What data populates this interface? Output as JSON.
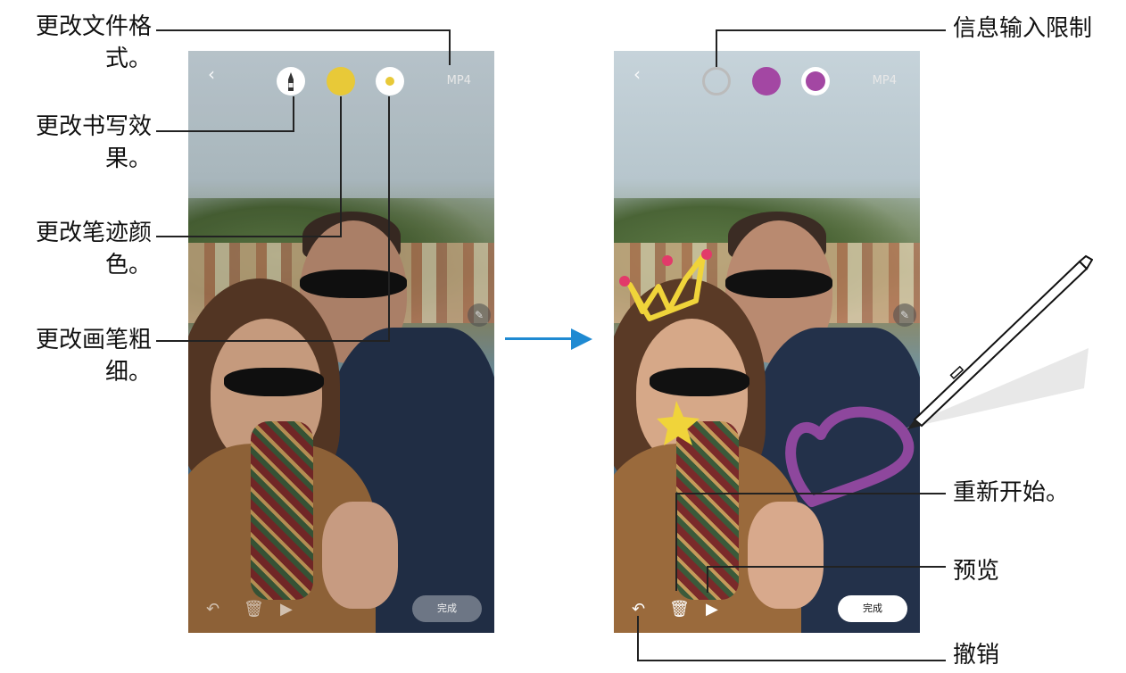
{
  "left_labels": {
    "file_format": [
      "更改文件格",
      "式。"
    ],
    "writing_effect": [
      "更改书写效",
      "果。"
    ],
    "pen_color": [
      "更改笔迹颜",
      "色。"
    ],
    "brush_size": [
      "更改画笔粗",
      "细。"
    ]
  },
  "right_labels": {
    "input_limit": "信息输入限制",
    "restart": "重新开始。",
    "preview": "预览",
    "undo": "撤销"
  },
  "screen": {
    "format": "MP4",
    "done_label": "完成",
    "back_glyph": "‹"
  },
  "colors": {
    "left_pen_color": "#e8c938",
    "right_pen_color": "#a347a3",
    "arrow": "#1f8ad2"
  },
  "icons": [
    "back-icon",
    "pen-effect-icon",
    "pen-color-icon",
    "pen-size-icon",
    "undo-icon",
    "trash-icon",
    "play-icon",
    "timer-ring-icon",
    "stylus-icon"
  ]
}
